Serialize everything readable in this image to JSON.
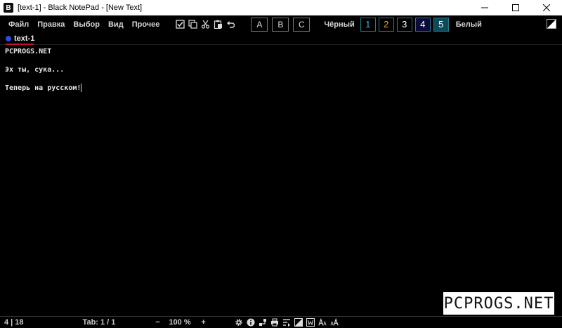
{
  "window": {
    "app_icon_letter": "B",
    "title": "[text-1] - Black NotePad - [New Text]"
  },
  "menu": [
    "Файл",
    "Правка",
    "Выбор",
    "Вид",
    "Прочее"
  ],
  "toolbar": {
    "font_buttons": [
      "A",
      "B",
      "C"
    ],
    "theme_dark_label": "Чёрный",
    "theme_light_label": "Белый",
    "themes": [
      {
        "label": "1",
        "color": "#3ab5e6",
        "bg": "#000000"
      },
      {
        "label": "2",
        "color": "#f0a030",
        "bg": "#000000"
      },
      {
        "label": "3",
        "color": "#ffffff",
        "bg": "#000000"
      },
      {
        "label": "4",
        "color": "#ffffff",
        "bg": "#0b0b3a"
      },
      {
        "label": "5",
        "color": "#ffffff",
        "bg": "#0d4a5c"
      }
    ]
  },
  "tab": {
    "label": "text-1",
    "dot_color": "#2a4fe0",
    "underline_color": "#c8102e"
  },
  "editor": {
    "lines": [
      "PCPROGS.NET",
      "",
      "Эх ты, сука...",
      "",
      "Теперь на русском!"
    ]
  },
  "watermark": "PCPROGS.NET",
  "status": {
    "position": "4 | 18",
    "tab": "Tab: 1 / 1",
    "zoom_minus": "−",
    "zoom": "100 %",
    "zoom_plus": "+"
  }
}
